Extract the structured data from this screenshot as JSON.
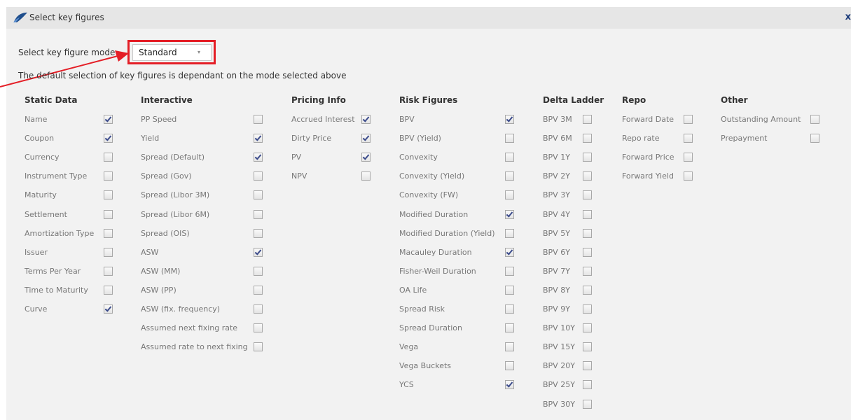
{
  "dialog": {
    "title": "Select key figures",
    "close_glyph": "x",
    "logo_icon": "app-logo-icon"
  },
  "mode": {
    "label": "Select key figure mode",
    "selected": "Standard",
    "caret": "▾",
    "description": "The default selection of key figures is dependant on the mode selected above"
  },
  "colors": {
    "highlight": "#e41e26",
    "checkmark": "#3a4a8a"
  },
  "columns": [
    {
      "name": "static-data",
      "header": "Static Data",
      "items": [
        {
          "label": "Name",
          "checked": true
        },
        {
          "label": "Coupon",
          "checked": true
        },
        {
          "label": "Currency",
          "checked": false
        },
        {
          "label": "Instrument Type",
          "checked": false
        },
        {
          "label": "Maturity",
          "checked": false
        },
        {
          "label": "Settlement",
          "checked": false
        },
        {
          "label": "Amortization Type",
          "checked": false
        },
        {
          "label": "Issuer",
          "checked": false
        },
        {
          "label": "Terms Per Year",
          "checked": false
        },
        {
          "label": "Time to Maturity",
          "checked": false
        },
        {
          "label": "Curve",
          "checked": true
        }
      ]
    },
    {
      "name": "interactive",
      "header": "Interactive",
      "items": [
        {
          "label": "PP Speed",
          "checked": false
        },
        {
          "label": "Yield",
          "checked": true
        },
        {
          "label": "Spread (Default)",
          "checked": true
        },
        {
          "label": "Spread (Gov)",
          "checked": false
        },
        {
          "label": "Spread (Libor 3M)",
          "checked": false
        },
        {
          "label": "Spread (Libor 6M)",
          "checked": false
        },
        {
          "label": "Spread (OIS)",
          "checked": false
        },
        {
          "label": "ASW",
          "checked": true
        },
        {
          "label": "ASW (MM)",
          "checked": false
        },
        {
          "label": "ASW (PP)",
          "checked": false
        },
        {
          "label": "ASW (fix. frequency)",
          "checked": false
        },
        {
          "label": "Assumed next fixing rate",
          "checked": false
        },
        {
          "label": "Assumed rate to next fixing",
          "checked": false
        }
      ]
    },
    {
      "name": "pricing-info",
      "header": "Pricing Info",
      "items": [
        {
          "label": "Accrued Interest",
          "checked": true
        },
        {
          "label": "Dirty Price",
          "checked": true
        },
        {
          "label": "PV",
          "checked": true
        },
        {
          "label": "NPV",
          "checked": false
        }
      ]
    },
    {
      "name": "risk-figures",
      "header": "Risk Figures",
      "items": [
        {
          "label": "BPV",
          "checked": true
        },
        {
          "label": "BPV (Yield)",
          "checked": false
        },
        {
          "label": "Convexity",
          "checked": false
        },
        {
          "label": "Convexity (Yield)",
          "checked": false
        },
        {
          "label": "Convexity (FW)",
          "checked": false
        },
        {
          "label": "Modified Duration",
          "checked": true
        },
        {
          "label": "Modified Duration (Yield)",
          "checked": false
        },
        {
          "label": "Macauley Duration",
          "checked": true
        },
        {
          "label": "Fisher-Weil Duration",
          "checked": false
        },
        {
          "label": "OA Life",
          "checked": false
        },
        {
          "label": "Spread Risk",
          "checked": false
        },
        {
          "label": "Spread Duration",
          "checked": false
        },
        {
          "label": "Vega",
          "checked": false
        },
        {
          "label": "Vega Buckets",
          "checked": false
        },
        {
          "label": "YCS",
          "checked": true
        }
      ]
    },
    {
      "name": "delta-ladder",
      "header": "Delta Ladder",
      "items": [
        {
          "label": "BPV 3M",
          "checked": false
        },
        {
          "label": "BPV 6M",
          "checked": false
        },
        {
          "label": "BPV 1Y",
          "checked": false
        },
        {
          "label": "BPV 2Y",
          "checked": false
        },
        {
          "label": "BPV 3Y",
          "checked": false
        },
        {
          "label": "BPV 4Y",
          "checked": false
        },
        {
          "label": "BPV 5Y",
          "checked": false
        },
        {
          "label": "BPV 6Y",
          "checked": false
        },
        {
          "label": "BPV 7Y",
          "checked": false
        },
        {
          "label": "BPV 8Y",
          "checked": false
        },
        {
          "label": "BPV 9Y",
          "checked": false
        },
        {
          "label": "BPV 10Y",
          "checked": false
        },
        {
          "label": "BPV 15Y",
          "checked": false
        },
        {
          "label": "BPV 20Y",
          "checked": false
        },
        {
          "label": "BPV 25Y",
          "checked": false
        },
        {
          "label": "BPV 30Y",
          "checked": false
        }
      ]
    },
    {
      "name": "repo",
      "header": "Repo",
      "items": [
        {
          "label": "Forward Date",
          "checked": false
        },
        {
          "label": "Repo rate",
          "checked": false
        },
        {
          "label": "Forward Price",
          "checked": false
        },
        {
          "label": "Forward Yield",
          "checked": false
        }
      ]
    },
    {
      "name": "other",
      "header": "Other",
      "items": [
        {
          "label": "Outstanding Amount",
          "checked": false
        },
        {
          "label": "Prepayment",
          "checked": false
        }
      ]
    }
  ]
}
